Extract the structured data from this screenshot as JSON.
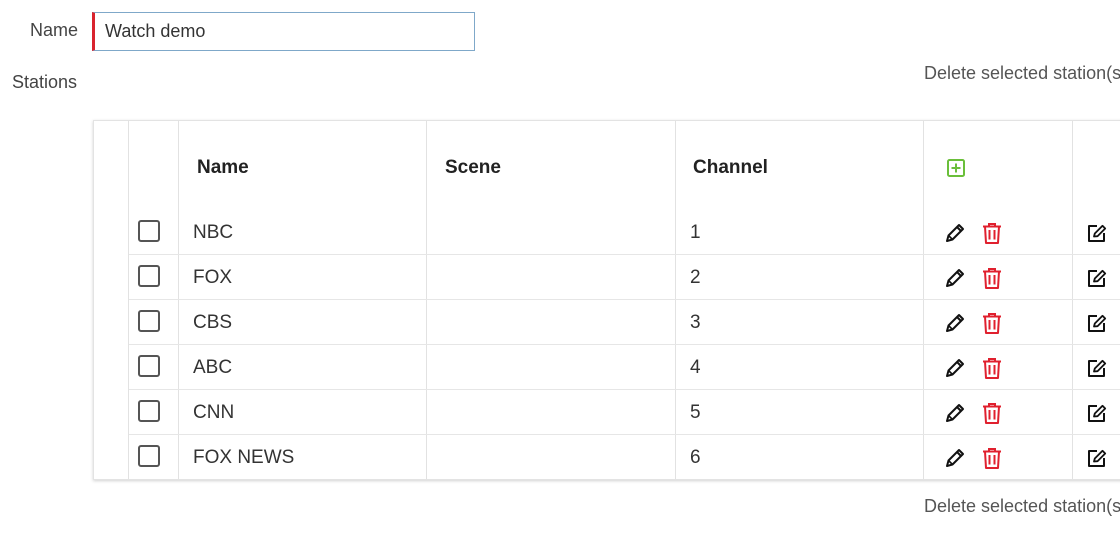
{
  "form": {
    "name_label": "Name",
    "name_value": "Watch demo",
    "stations_label": "Stations",
    "delete_selected_label": "Delete selected station(s)"
  },
  "table": {
    "headers": {
      "name": "Name",
      "scene": "Scene",
      "channel": "Channel"
    },
    "rows": [
      {
        "name": "NBC",
        "scene": "",
        "channel": "1"
      },
      {
        "name": "FOX",
        "scene": "",
        "channel": "2"
      },
      {
        "name": "CBS",
        "scene": "",
        "channel": "3"
      },
      {
        "name": "ABC",
        "scene": "",
        "channel": "4"
      },
      {
        "name": "CNN",
        "scene": "",
        "channel": "5"
      },
      {
        "name": "FOX NEWS",
        "scene": "",
        "channel": "6"
      }
    ]
  },
  "icons": {
    "add": "plus-square-icon",
    "edit": "pencil-icon",
    "delete": "trash-icon",
    "open": "edit-square-icon"
  },
  "colors": {
    "add": "#6abf3a",
    "delete": "#e0202e",
    "input_accent": "#d9232e"
  }
}
